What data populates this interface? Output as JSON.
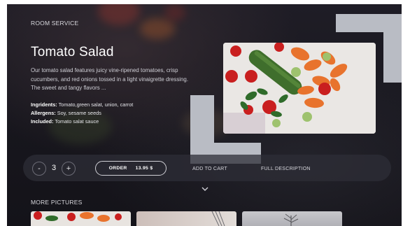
{
  "header": {
    "section_label": "ROOM SERVICE"
  },
  "dish": {
    "title": "Tomato Salad",
    "description": "Our tomato salad features juicy vine-ripened tomatoes, crisp cucumbers, and red onions tossed in a light vinaigrette dressing. The sweet and tangy flavors ...",
    "ingredients_label": "Ingridents:",
    "ingredients_value": "Tomato,green salat, union, carrot",
    "allergens_label": "Allergens:",
    "allergens_value": "Soy, sesame seeds",
    "included_label": "Included:",
    "included_value": "Tomato salat sauce"
  },
  "actions": {
    "minus_label": "-",
    "quantity": "3",
    "plus_label": "+",
    "order_label": "ORDER",
    "order_price": "13.95 $",
    "add_to_cart_label": "ADD TO CART",
    "full_description_label": "FULL DESCRIPTION",
    "expand_icon": "chevron-down-icon"
  },
  "more_pictures": {
    "label": "MORE PICTURES"
  },
  "colors": {
    "background": "#1b1a21",
    "deco_block": "#b9bcc4",
    "accent_text": "#ffffff"
  }
}
